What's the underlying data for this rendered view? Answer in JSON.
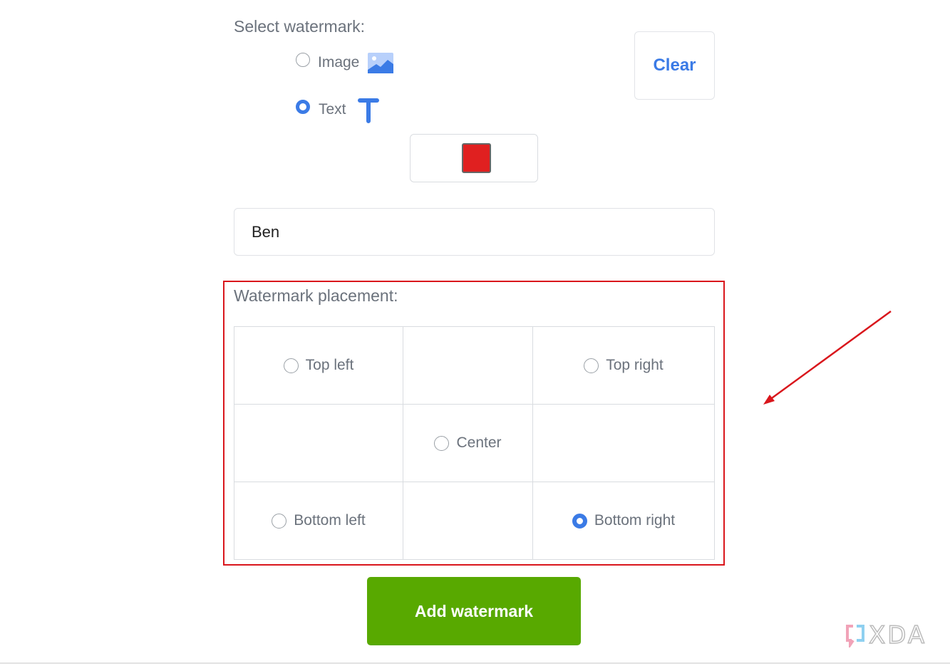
{
  "select_watermark": {
    "label": "Select watermark:",
    "options": [
      {
        "label": "Image",
        "icon": "image-icon",
        "selected": false
      },
      {
        "label": "Text",
        "icon": "text-t-icon",
        "selected": true
      }
    ],
    "clear_label": "Clear",
    "color": "#e02020"
  },
  "text_input": {
    "value": "Ben"
  },
  "placement": {
    "label": "Watermark placement:",
    "options": [
      {
        "label": "Top left",
        "selected": false
      },
      {
        "label": "Top right",
        "selected": false
      },
      {
        "label": "Center",
        "selected": false
      },
      {
        "label": "Bottom left",
        "selected": false
      },
      {
        "label": "Bottom right",
        "selected": true
      }
    ]
  },
  "add_button": {
    "label": "Add watermark"
  },
  "logo": {
    "text": "XDA"
  },
  "colors": {
    "accent": "#3b7be6",
    "primary_button": "#58a900",
    "highlight": "#d9161c"
  }
}
